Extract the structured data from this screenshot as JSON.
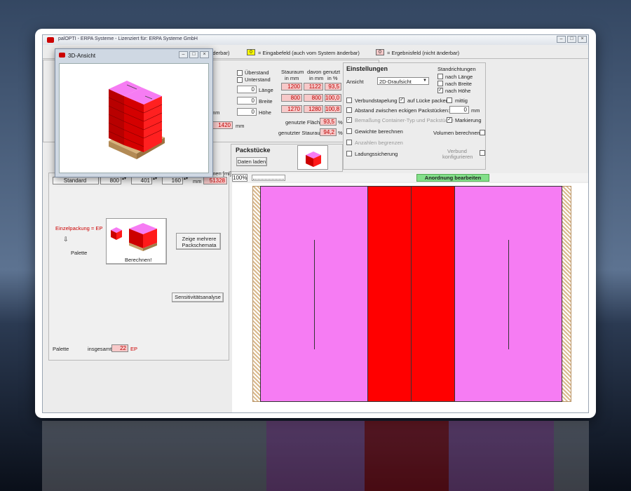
{
  "window": {
    "title": "palOPTI - ERPA Systeme - Lizenziert für: ERPA Systeme GmbH",
    "buttons": [
      "–",
      "□",
      "×"
    ]
  },
  "legend": {
    "input_partial": "änderbar)",
    "input_value": "0",
    "input_label": "= Eingabefeld (auch vom System änderbar)",
    "result_value": "0",
    "result_label": "= Ergebnisfeld (nicht änderbar)"
  },
  "dialog": {
    "title": "3D-Ansicht",
    "buttons": [
      "–",
      "□",
      "×"
    ]
  },
  "overhang": {
    "ueberstand": "Überstand",
    "unterstand": "Unterstand",
    "laenge_label": "Länge",
    "breite_label": "Breite",
    "hoehe_label": "Höhe",
    "laenge_in": "0",
    "breite_in": "0",
    "hoehe_in": "0",
    "mm": "mm",
    "e_label": "e",
    "e_value": "1420",
    "e_unit": "mm"
  },
  "stauraum": {
    "col1": "Stauraum",
    "col1b": "in mm",
    "col2": "davon genutzt",
    "col2b": "in mm",
    "col3": "in %",
    "rows": [
      {
        "a": "1200",
        "b": "1122",
        "c": "93,5"
      },
      {
        "a": "800",
        "b": "800",
        "c": "100,0"
      },
      {
        "a": "1270",
        "b": "1280",
        "c": "100,8"
      }
    ],
    "flaeche_label": "genutzte Fläche",
    "flaeche_value": "93,5",
    "raum_label": "genutzter Stauraum",
    "raum_value": "94,2",
    "pct": "%"
  },
  "settings": {
    "title": "Einstellungen",
    "ansicht_label": "Ansicht",
    "ansicht_value": "2D-Draufsicht",
    "standrichtungen": "Standrichtungen",
    "nach_laenge": "nach Länge",
    "nach_breite": "nach Breite",
    "nach_hoehe": "nach Höhe",
    "verbundstapelung": "Verbundstapelung",
    "auf_luecke": "auf Lücke packen",
    "mittig": "mittig",
    "abstand": "Abstand zwischen eckigen Packstücken:",
    "abstand_value": "0",
    "abstand_unit": "mm",
    "bemassung": "Bemaßung Container-Typ und Packstücke",
    "markierung": "Markierung",
    "gewichte": "Gewichte berechnen",
    "volumen": "Volumen berechnen",
    "anzahlen": "Anzahlen begrenzen",
    "ladungssicherung": "Ladungssicherung",
    "verbund": "Verbund",
    "konfigurieren": "konfigurieren"
  },
  "packstuecke": {
    "title": "Packstücke",
    "daten_laden": "Daten laden"
  },
  "left": {
    "volumen_header": "umen [ml]",
    "standard": "Standard",
    "dim1": "800",
    "dim2": "401",
    "dim3": "160",
    "mm": "mm",
    "volumen_value": "51328",
    "einzel": "Einzelpackung = EP",
    "arrow": "⇩",
    "palette": "Palette",
    "berechnen": "Berechnen!",
    "zeige_mehrere": "Zeige mehrere\nPackschemata",
    "sensitivitaet": "Sensitivitätsanalyse",
    "footer_palette": "Palette",
    "insgesamt": "insgesamt",
    "total": "22",
    "ep": "EP"
  },
  "viewer": {
    "zoom": "100%",
    "anordnung": "Anordnung bearbeiten"
  },
  "colors": {
    "magenta": "#f67cf3",
    "red": "#ff0000",
    "yellow": "#ffff00",
    "pink": "#f7c9c9",
    "green": "#83e08a"
  }
}
